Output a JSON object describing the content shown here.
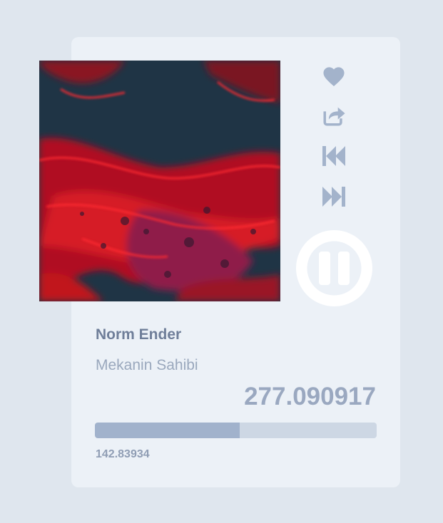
{
  "player": {
    "track_title": "Norm Ender",
    "track_artist": "Mekanin Sahibi",
    "duration": "277.090917",
    "current_time": "142.83934",
    "progress_fraction": 0.515,
    "state": "playing",
    "icons": {
      "like": "heart-icon",
      "share": "share-icon",
      "previous": "previous-icon",
      "next": "next-icon",
      "play_pause": "pause-icon"
    },
    "colors": {
      "background": "#dfe6ee",
      "card": "#ecf1f7",
      "icon": "#a3b3cb",
      "progress_track": "#cdd7e4",
      "progress_fill": "#a1b2cc"
    }
  }
}
